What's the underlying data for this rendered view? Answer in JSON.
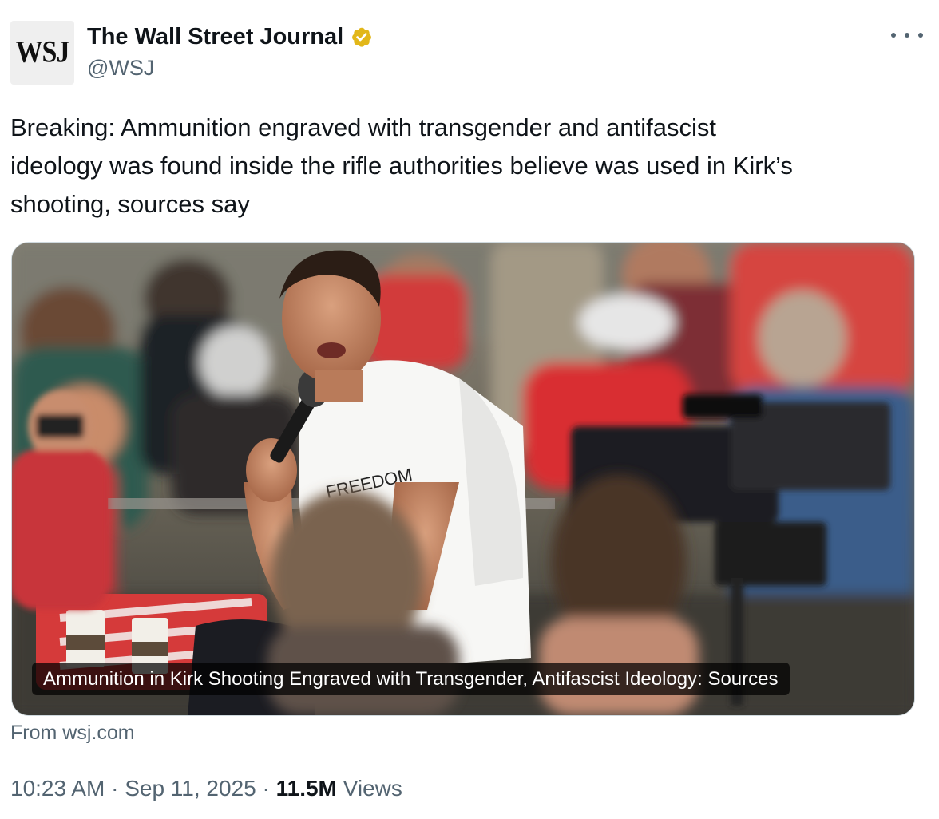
{
  "account": {
    "avatar_text": "WSJ",
    "display_name": "The Wall Street Journal",
    "handle": "@WSJ",
    "verified_color": "#e2b719"
  },
  "tweet": {
    "text": "Breaking: Ammunition engraved with transgender and antifascist\nideology was found inside the rifle authorities believe was used in Kirk’s\nshooting, sources say"
  },
  "card": {
    "image_alt": "Man in white t-shirt speaking into microphone at outdoor event with crowd and camera",
    "shirt_text": "FREEDOM",
    "caption": "Ammunition in Kirk Shooting Engraved with Transgender, Antifascist Ideology: Sources",
    "source": "From wsj.com"
  },
  "meta": {
    "time": "10:23 AM",
    "separator": " · ",
    "date": "Sep 11, 2025",
    "views_count": "11.5M",
    "views_label": "Views"
  },
  "icons": {
    "verified": "verified-badge-icon",
    "more": "more-options-icon"
  }
}
